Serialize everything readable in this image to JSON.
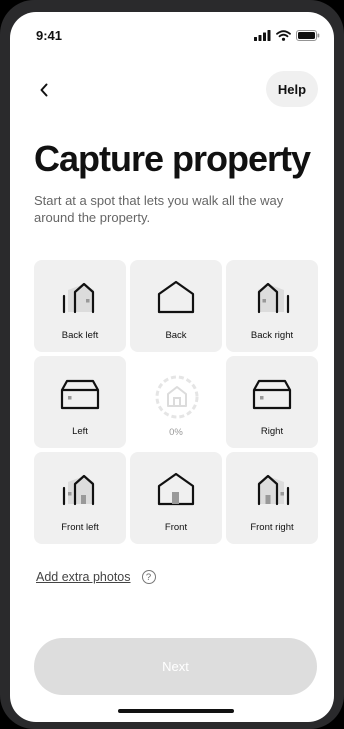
{
  "status_bar": {
    "time": "9:41"
  },
  "nav": {
    "help_label": "Help"
  },
  "page": {
    "title": "Capture property",
    "subtitle": "Start at a spot that lets you walk all the way around the property."
  },
  "angles": [
    {
      "label": "Back left",
      "icon": "house-back-left-icon"
    },
    {
      "label": "Back",
      "icon": "house-back-icon"
    },
    {
      "label": "Back right",
      "icon": "house-back-right-icon"
    },
    {
      "label": "Left",
      "icon": "house-left-icon"
    },
    {
      "label": "Right",
      "icon": "house-right-icon"
    },
    {
      "label": "Front left",
      "icon": "house-front-left-icon"
    },
    {
      "label": "Front",
      "icon": "house-front-icon"
    },
    {
      "label": "Front right",
      "icon": "house-front-right-icon"
    }
  ],
  "progress": {
    "value_label": "0%",
    "fraction": 0.0
  },
  "extra": {
    "link_label": "Add extra photos",
    "help_glyph": "?"
  },
  "footer": {
    "next_label": "Next"
  },
  "colors": {
    "accent_text": "#111111",
    "tile_bg": "#f0f0f0",
    "disabled_button": "#dddddd",
    "muted_text": "#666666"
  }
}
